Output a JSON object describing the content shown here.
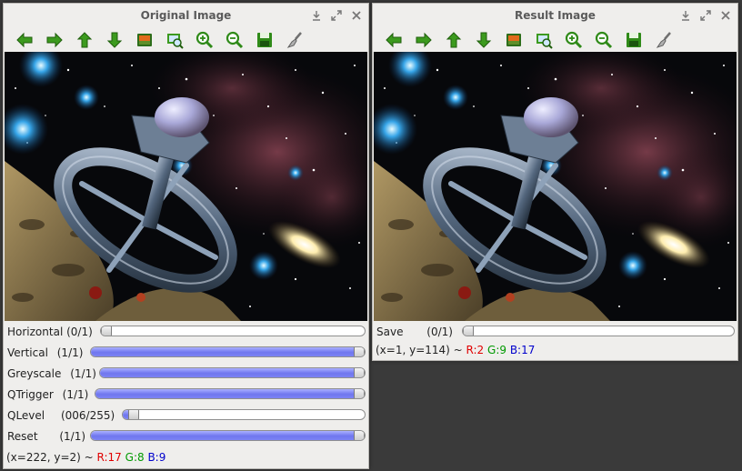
{
  "original_window": {
    "title": "Original Image",
    "toolbar": [
      "pan-left-icon",
      "pan-right-icon",
      "pan-up-icon",
      "pan-down-icon",
      "image-icon",
      "zoom-fit-icon",
      "zoom-in-icon",
      "zoom-out-icon",
      "save-icon",
      "brush-icon"
    ],
    "controls": [
      {
        "label": "Horizontal",
        "count": "(0/1)",
        "value": 0
      },
      {
        "label": "Vertical",
        "count": "(1/1)",
        "value": 1
      },
      {
        "label": "Greyscale",
        "count": "(1/1)",
        "value": 1
      },
      {
        "label": "QTrigger",
        "count": "(1/1)",
        "value": 1
      },
      {
        "label": "QLevel",
        "count": "(006/255)",
        "value": 0.0235
      },
      {
        "label": "Reset",
        "count": "(1/1)",
        "value": 1
      }
    ],
    "status": {
      "coords": "(x=222, y=2) ~ ",
      "r": "R:17",
      "g": "G:8",
      "b": "B:9"
    }
  },
  "result_window": {
    "title": "Result Image",
    "toolbar": [
      "pan-left-icon",
      "pan-right-icon",
      "pan-up-icon",
      "pan-down-icon",
      "image-icon",
      "zoom-fit-icon",
      "zoom-in-icon",
      "zoom-out-icon",
      "save-icon",
      "brush-icon"
    ],
    "controls": [
      {
        "label": "Save",
        "count": "(0/1)",
        "value": 0
      }
    ],
    "status": {
      "coords": "(x=1, y=114) ~ ",
      "r": "R:2",
      "g": "G:9",
      "b": "B:17"
    }
  },
  "colors": {
    "icon_green": "#3c9a1e",
    "slider_fill": "#7a80f2",
    "r": "#e00000",
    "g": "#009900",
    "b": "#0000cc"
  }
}
